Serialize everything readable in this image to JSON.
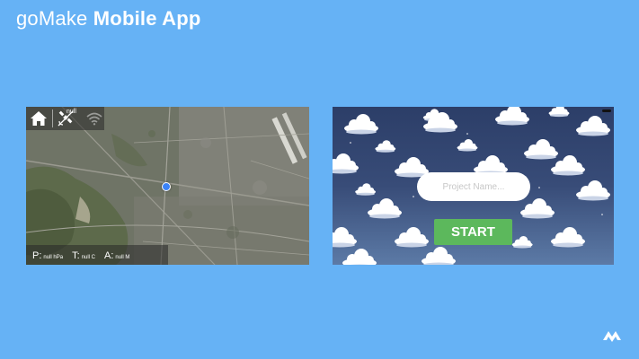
{
  "slide": {
    "title_light": "goMake",
    "title_bold": "Mobile App"
  },
  "map_screen": {
    "gps_status": "null",
    "readings": [
      {
        "key": "P:",
        "value": "null hPa"
      },
      {
        "key": "T:",
        "value": "null C"
      },
      {
        "key": "A:",
        "value": "null M"
      }
    ],
    "icons": [
      "home-icon",
      "satellite-icon",
      "wifi-icon"
    ],
    "location_marker_color": "#3b82f6"
  },
  "start_screen": {
    "project_name_placeholder": "Project Name...",
    "start_label": "START",
    "start_color": "#5cb85c"
  },
  "colors": {
    "background": "#66b2f5"
  }
}
